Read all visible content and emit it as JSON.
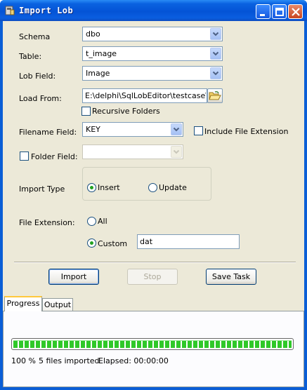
{
  "window": {
    "title": "Import Lob"
  },
  "form": {
    "schema": {
      "label": "Schema",
      "value": "dbo"
    },
    "table": {
      "label": "Table:",
      "value": "t_image"
    },
    "lob_field": {
      "label": "Lob Field:",
      "value": "Image"
    },
    "load_from": {
      "label": "Load From:",
      "value": "E:\\delphi\\SqlLobEditor\\testcase\\f"
    },
    "recursive_folders": {
      "label": "Recursive Folders",
      "checked": false
    },
    "filename_field": {
      "label": "Filename Field:",
      "value": "KEY"
    },
    "include_file_extension": {
      "label": "Include File Extension",
      "checked": false
    },
    "folder_field": {
      "label": "Folder Field:",
      "checked": false,
      "value": ""
    },
    "import_type": {
      "label": "Import Type",
      "options": [
        "Insert",
        "Update"
      ],
      "selected": "Insert"
    },
    "file_extension": {
      "label": "File Extension:",
      "options": [
        "All",
        "Custom"
      ],
      "selected": "Custom",
      "custom_value": "dat"
    }
  },
  "buttons": {
    "import": "Import",
    "stop": "Stop",
    "save_task": "Save Task"
  },
  "tabs": [
    {
      "label": "Progress",
      "active": true
    },
    {
      "label": "Output",
      "active": false
    }
  ],
  "progress": {
    "percent": 100,
    "percent_text": "100 %",
    "files_text": "5 files imported",
    "elapsed_text": "Elapsed: 00:00:00"
  },
  "colors": {
    "titlebar": "#0453d6",
    "progress_fill": "#2fc828",
    "face": "#ece9d8"
  }
}
